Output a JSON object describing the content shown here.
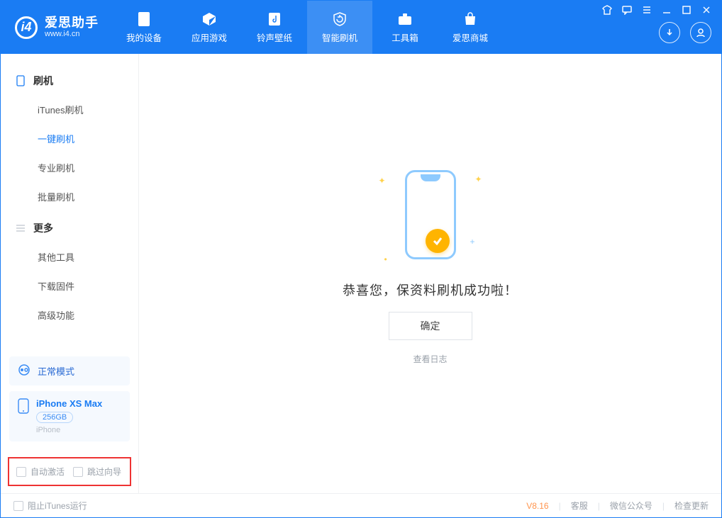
{
  "brand": {
    "name_cn": "爱思助手",
    "domain": "www.i4.cn"
  },
  "top_tabs": [
    {
      "id": "device",
      "label": "我的设备"
    },
    {
      "id": "apps",
      "label": "应用游戏"
    },
    {
      "id": "ring",
      "label": "铃声壁纸"
    },
    {
      "id": "flash",
      "label": "智能刷机",
      "active": true
    },
    {
      "id": "toolbox",
      "label": "工具箱"
    },
    {
      "id": "store",
      "label": "爱思商城"
    }
  ],
  "sidebar": {
    "groups": [
      {
        "id": "flash",
        "title": "刷机",
        "items": [
          {
            "id": "itunes",
            "label": "iTunes刷机"
          },
          {
            "id": "oneclick",
            "label": "一键刷机",
            "active": true
          },
          {
            "id": "pro",
            "label": "专业刷机"
          },
          {
            "id": "batch",
            "label": "批量刷机"
          }
        ]
      },
      {
        "id": "more",
        "title": "更多",
        "items": [
          {
            "id": "other",
            "label": "其他工具"
          },
          {
            "id": "firmware",
            "label": "下载固件"
          },
          {
            "id": "advanced",
            "label": "高级功能"
          }
        ]
      }
    ],
    "mode_label": "正常模式",
    "device": {
      "name": "iPhone XS Max",
      "capacity": "256GB",
      "type": "iPhone"
    },
    "foot": {
      "auto_activate": "自动激活",
      "skip_guide": "跳过向导"
    }
  },
  "main": {
    "success_msg": "恭喜您，保资料刷机成功啦！",
    "ok_label": "确定",
    "view_log_label": "查看日志"
  },
  "status": {
    "block_itunes": "阻止iTunes运行",
    "version": "V8.16",
    "support": "客服",
    "wechat": "微信公众号",
    "check_update": "检查更新"
  }
}
